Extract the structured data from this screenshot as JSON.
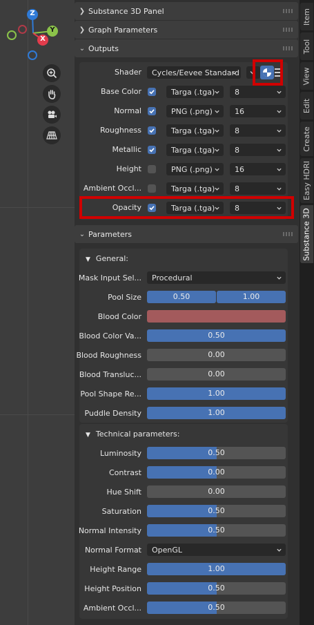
{
  "colors": {
    "accent": "#4772b3",
    "highlight": "#d00000",
    "blood_color": "#a35a5c",
    "x_axis": "#e33c4c",
    "y_axis": "#8bc34a",
    "z_axis": "#2f7ad6"
  },
  "gizmo": {
    "z": "Z",
    "y": "Y",
    "x": "X"
  },
  "tools": [
    "zoom-icon",
    "hand-pan-icon",
    "camera-icon",
    "perspective-grid-icon"
  ],
  "tabs": [
    "Item",
    "Tool",
    "View",
    "Edit",
    "Create",
    "Easy HDRI",
    "Substance 3D"
  ],
  "headers": {
    "panel": "Substance 3D Panel",
    "graph": "Graph Parameters",
    "outputs": "Outputs",
    "parameters": "Parameters"
  },
  "outputs": {
    "shader_label": "Shader",
    "shader_value": "Cycles/Eevee Standard",
    "rows": [
      {
        "label": "Base Color",
        "checked": true,
        "format": "Targa (.tga)",
        "bits": "8"
      },
      {
        "label": "Normal",
        "checked": true,
        "format": "PNG (.png)",
        "bits": "16"
      },
      {
        "label": "Roughness",
        "checked": true,
        "format": "Targa (.tga)",
        "bits": "8"
      },
      {
        "label": "Metallic",
        "checked": true,
        "format": "Targa (.tga)",
        "bits": "8"
      },
      {
        "label": "Height",
        "checked": false,
        "format": "PNG (.png)",
        "bits": "16"
      },
      {
        "label": "Ambient Occl...",
        "checked": false,
        "format": "Targa (.tga)",
        "bits": "8"
      },
      {
        "label": "Opacity",
        "checked": true,
        "format": "Targa (.tga)",
        "bits": "8"
      }
    ]
  },
  "general": {
    "title": "General:",
    "mask_label": "Mask Input Sel...",
    "mask_value": "Procedural",
    "pool_size_label": "Pool Size",
    "pool_size_values": [
      "0.50",
      "1.00"
    ],
    "blood_color_label": "Blood Color",
    "sliders": [
      {
        "label": "Blood Color Va...",
        "value": "0.50",
        "fill": 1.0
      },
      {
        "label": "Blood Roughness",
        "value": "0.00",
        "fill": 0.0
      },
      {
        "label": "Blood Transluc...",
        "value": "0.00",
        "fill": 0.0
      },
      {
        "label": "Pool Shape Re...",
        "value": "1.00",
        "fill": 1.0
      },
      {
        "label": "Puddle Density",
        "value": "1.00",
        "fill": 1.0
      }
    ]
  },
  "technical": {
    "title": "Technical parameters:",
    "sliders_a": [
      {
        "label": "Luminosity",
        "value": "0.50",
        "fill": 0.5
      },
      {
        "label": "Contrast",
        "value": "0.00",
        "fill": 0.5
      },
      {
        "label": "Hue Shift",
        "value": "0.00",
        "fill": 0.0
      },
      {
        "label": "Saturation",
        "value": "0.50",
        "fill": 0.5
      },
      {
        "label": "Normal Intensity",
        "value": "0.50",
        "fill": 0.5
      }
    ],
    "normal_format_label": "Normal Format",
    "normal_format_value": "OpenGL",
    "sliders_b": [
      {
        "label": "Height Range",
        "value": "1.00",
        "fill": 1.0
      },
      {
        "label": "Height Position",
        "value": "0.50",
        "fill": 0.5
      },
      {
        "label": "Ambient Occl...",
        "value": "0.50",
        "fill": 0.5
      }
    ]
  }
}
